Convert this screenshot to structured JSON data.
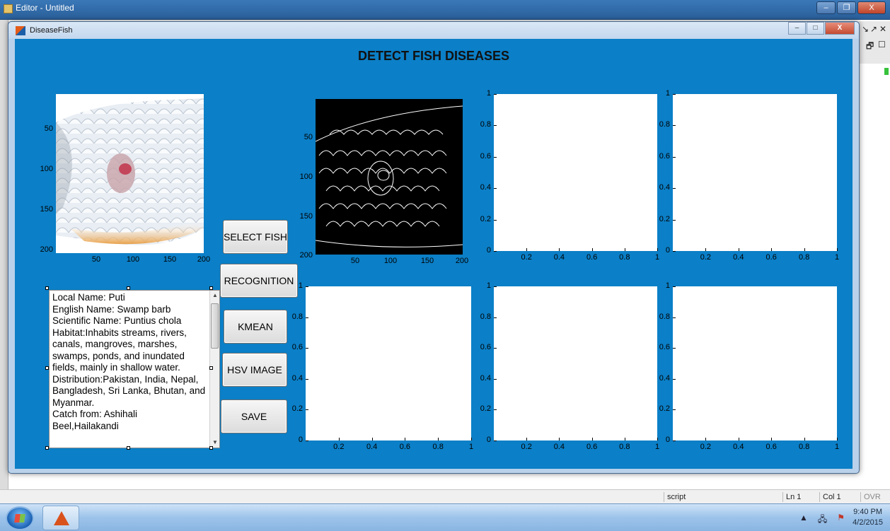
{
  "editor": {
    "title": "Editor - Untitled",
    "controls": {
      "minimize": "–",
      "maximize": "❐",
      "close": "X"
    },
    "right_tools": [
      "↘",
      "↗",
      "✕",
      "🗗",
      "☐"
    ],
    "status": {
      "mode": "script",
      "line": "Ln 1",
      "col": "Col 1",
      "ovr": "OVR"
    }
  },
  "taskbar": {
    "clock_time": "9:40 PM",
    "clock_date": "4/2/2015",
    "tray_icons": [
      "tray-arrow-icon",
      "network-icon",
      "flag-icon"
    ]
  },
  "figure": {
    "title": "DiseaseFish",
    "controls": {
      "minimize": "–",
      "maximize": "□",
      "close": "X"
    },
    "app_title": "DETECT FISH DISEASES",
    "buttons": {
      "select_fish": "SELECT FISH",
      "recognition": "RECOGNITION",
      "kmean": "KMEAN",
      "hsv_image": "HSV IMAGE",
      "save": "SAVE"
    },
    "info_text": "Local Name: Puti\nEnglish Name: Swamp barb\nScientific Name: Puntius chola\nHabitat:Inhabits streams, rivers, canals, mangroves, marshes, swamps, ponds, and inundated fields, mainly in shallow water.\nDistribution:Pakistan, India, Nepal, Bangladesh, Sri Lanka, Bhutan, and Myanmar.\nCatch from: Ashihali\nBeel,Hailakandi",
    "image_axes_ticks": {
      "x": [
        "50",
        "100",
        "150",
        "200"
      ],
      "y": [
        "50",
        "100",
        "150",
        "200"
      ]
    },
    "plot_axes_ticks": {
      "x": [
        "0.2",
        "0.4",
        "0.6",
        "0.8",
        "1"
      ],
      "y": [
        "0",
        "0.2",
        "0.4",
        "0.6",
        "0.8",
        "1"
      ]
    }
  }
}
